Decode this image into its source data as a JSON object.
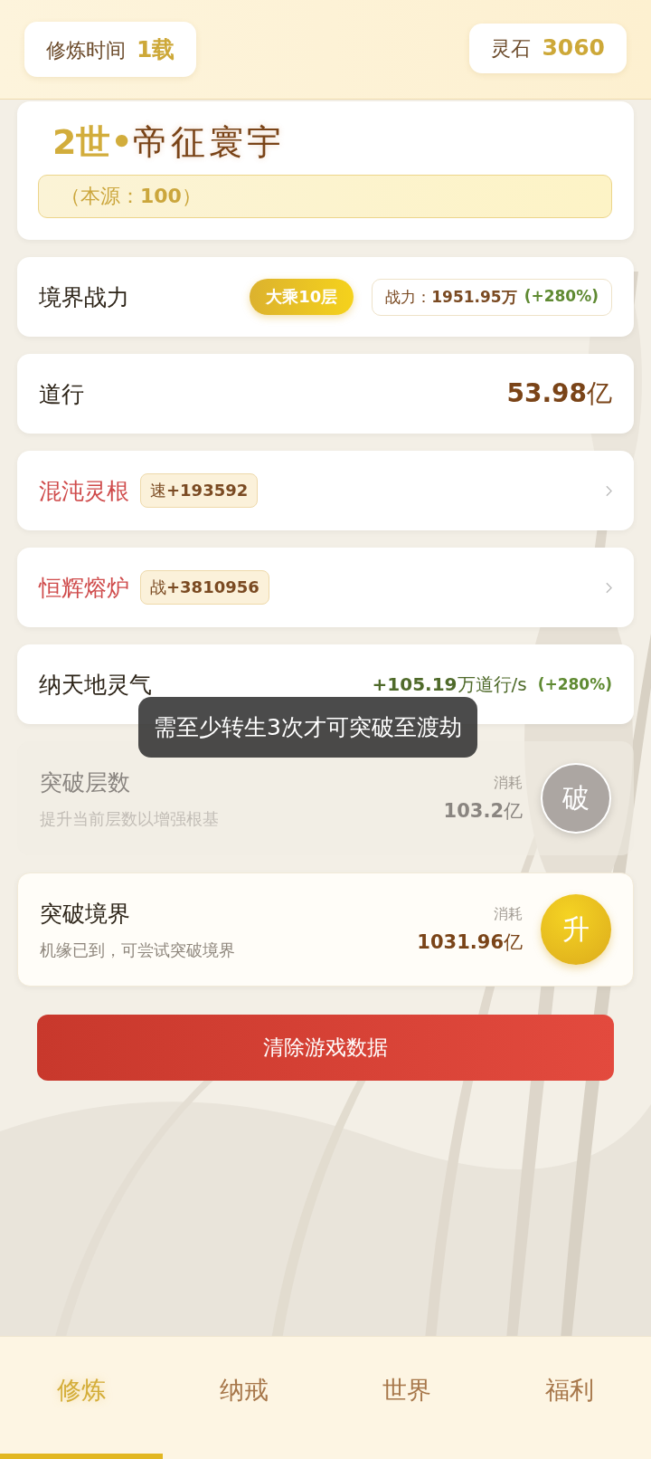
{
  "header": {
    "time_label": "修炼时间",
    "time_value": "1载",
    "stone_label": "灵石",
    "stone_value": "3060"
  },
  "title": {
    "prefix": "2世•",
    "name": "帝征寰宇",
    "origin": "（本源：**100**）"
  },
  "rows": [
    {
      "kind": "realm",
      "label": "境界战力",
      "badge": "大乘10层",
      "power": "战力：**1951.95万**",
      "bonus": "(+280%)"
    },
    {
      "kind": "value",
      "label": "道行",
      "value": "**53.98**亿"
    },
    {
      "kind": "link",
      "label": "混沌灵根",
      "tag": "速**+193592**"
    },
    {
      "kind": "link",
      "label": "恒辉熔炉",
      "tag": "战**+3810956**"
    },
    {
      "kind": "rate",
      "label": "纳天地灵气",
      "value": "**+105.19**万道行/s",
      "bonus": "(+280%)"
    },
    {
      "kind": "action",
      "label": "突破层数",
      "desc": "提升当前层数以增强根基",
      "cost_label": "消耗",
      "cost": "**103.2**亿",
      "action": "破",
      "disabled": true
    },
    {
      "kind": "action",
      "label": "突破境界",
      "desc": "机缘已到，可尝试突破境界",
      "cost_label": "消耗",
      "cost": "**1031.96**亿",
      "action": "升",
      "disabled": false
    }
  ],
  "clear_button": "清除游戏数据",
  "toast": "需至少转生3次才可突破至渡劫",
  "tabs": [
    {
      "label": "修炼",
      "selected": true
    },
    {
      "label": "纳戒",
      "selected": false
    },
    {
      "label": "世界",
      "selected": false
    },
    {
      "label": "福利",
      "selected": false
    }
  ]
}
